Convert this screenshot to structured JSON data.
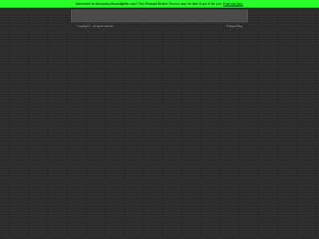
{
  "banner": {
    "message": "Interested in thomasbaylissandgibbs.com? Our Domain Broker Service may be able to get it for you.",
    "link_label": "Find out how.",
    "background_color": "#2bff2b"
  },
  "footer": {
    "copyright": "Copyright © . All rights reserved.",
    "privacy_label": "Privacy Policy"
  },
  "page": {
    "background_color": "#2f2f2f"
  }
}
